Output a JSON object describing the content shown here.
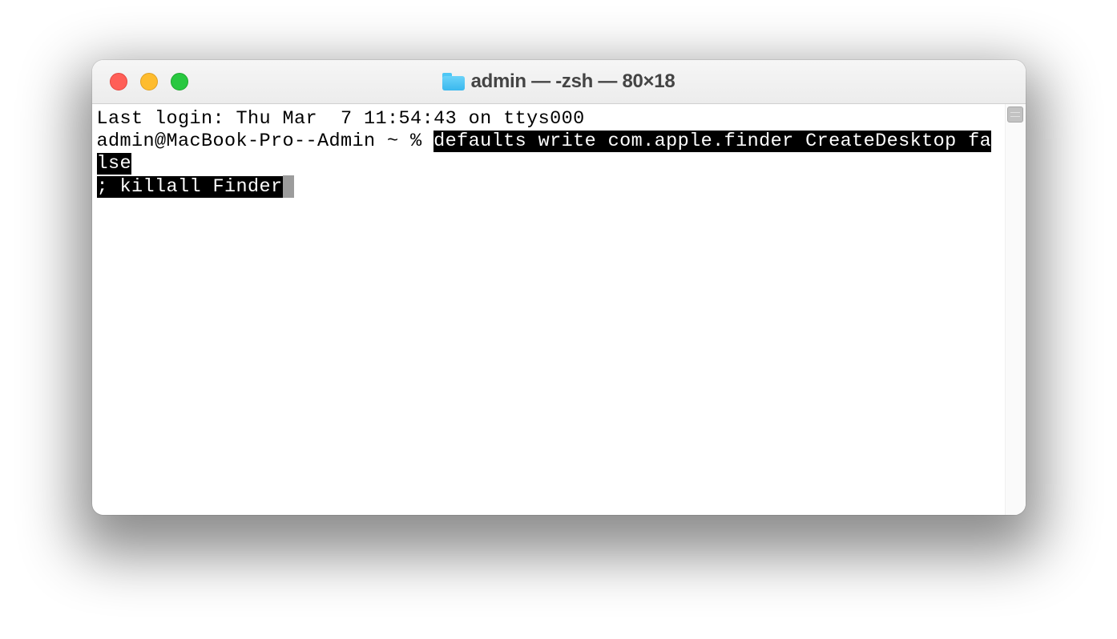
{
  "window": {
    "title": "admin — -zsh — 80×18"
  },
  "terminal": {
    "last_login_line": "Last login: Thu Mar  7 11:54:43 on ttys000",
    "prompt": "admin@MacBook-Pro--Admin ~ % ",
    "command_selected_part1": "defaults write com.apple.finder CreateDesktop false",
    "command_selected_part2": "; killall Finder"
  },
  "colors": {
    "close": "#ff5f57",
    "minimize": "#febc2e",
    "maximize": "#28c840"
  }
}
